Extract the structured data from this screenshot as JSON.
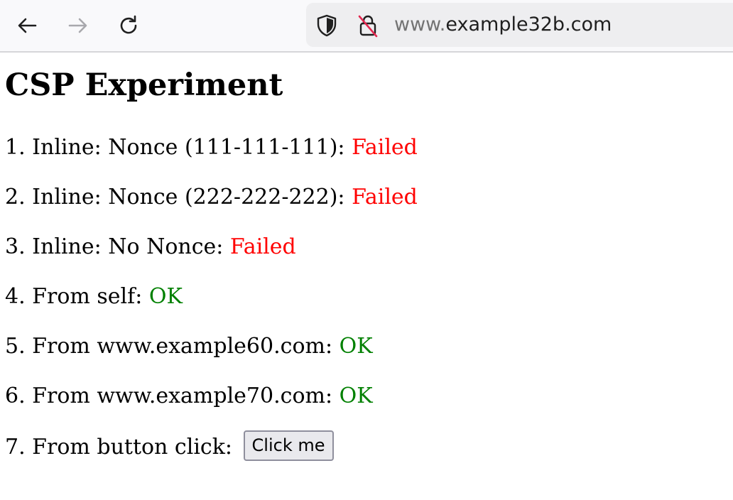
{
  "browser": {
    "url_subdomain": "www.",
    "url_domain": "example32b.com",
    "icons": {
      "back": "arrow-left-icon",
      "forward": "arrow-right-icon",
      "reload": "reload-icon",
      "tracking": "shield-icon",
      "security": "insecure-lock-icon"
    }
  },
  "page": {
    "title": "CSP Experiment",
    "tests": [
      {
        "label": "1. Inline: Nonce (111-111-111): ",
        "status": "Failed"
      },
      {
        "label": "2. Inline: Nonce (222-222-222): ",
        "status": "Failed"
      },
      {
        "label": "3. Inline: No Nonce: ",
        "status": "Failed"
      },
      {
        "label": "4. From self: ",
        "status": "OK"
      },
      {
        "label": "5. From www.example60.com: ",
        "status": "OK"
      },
      {
        "label": "6. From www.example70.com: ",
        "status": "OK"
      }
    ],
    "button_test": {
      "label": "7. From button click: ",
      "button_label": "Click me"
    }
  },
  "colors": {
    "failed": "#ff0000",
    "ok": "#008000"
  }
}
